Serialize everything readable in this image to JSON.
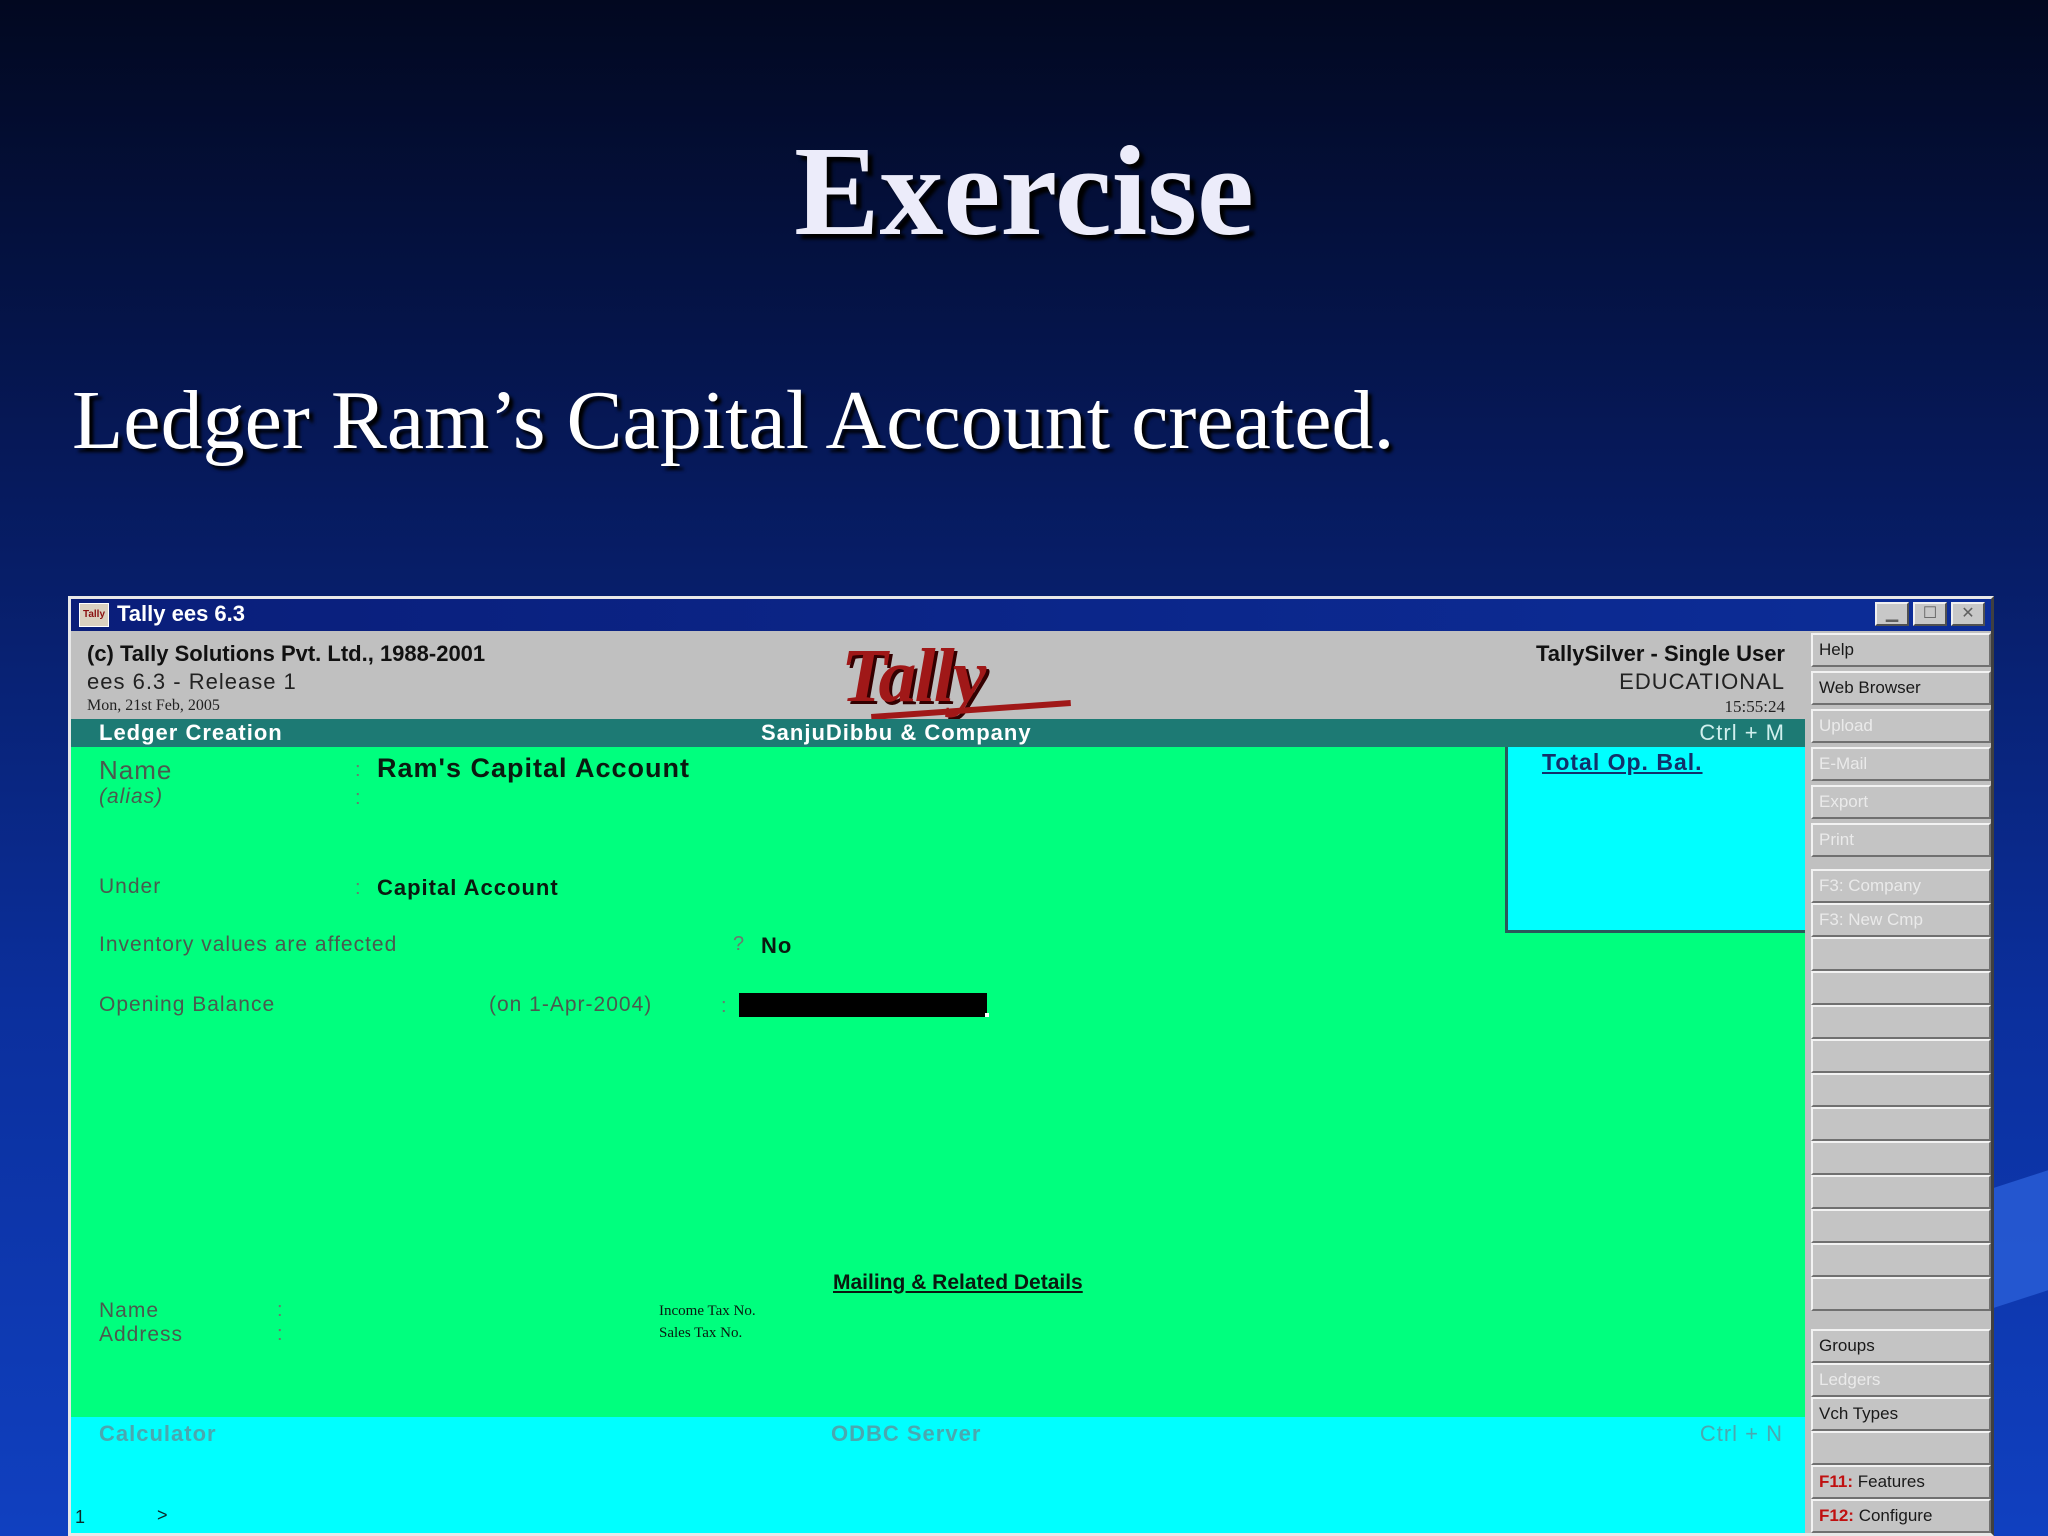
{
  "slide": {
    "title": "Exercise",
    "subtitle": "Ledger Ram’s Capital Account created."
  },
  "window": {
    "title": "Tally ees 6.3",
    "icon_text": "Tally",
    "controls": [
      "minimize-icon",
      "maximize-icon",
      "close-icon"
    ]
  },
  "header": {
    "copyright": "(c) Tally Solutions Pvt. Ltd., 1988-2001",
    "release": "ees 6.3 - Release 1",
    "date": "Mon, 21st Feb, 2005",
    "logo": "Tally",
    "product": "TallySilver - Single User",
    "edition": "EDUCATIONAL",
    "time": "15:55:24"
  },
  "strip": {
    "screen": "Ledger Creation",
    "company": "SanjuDibbu & Company",
    "shortcut": "Ctrl + M"
  },
  "form": {
    "name_label": "Name",
    "name_value": "Ram's Capital Account",
    "alias_label": "(alias)",
    "under_label": "Under",
    "under_value": "Capital Account",
    "inventory_label": "Inventory values are affected",
    "inventory_q": "?",
    "inventory_value": "No",
    "opening_label": "Opening Balance",
    "opening_date": "(on 1-Apr-2004)",
    "colon": ":"
  },
  "opbal_panel": {
    "title": "Total Op. Bal."
  },
  "mailing": {
    "title": "Mailing & Related Details",
    "name_label": "Name",
    "address_label": "Address",
    "income_tax_label": "Income Tax No.",
    "sales_tax_label": "Sales Tax No."
  },
  "bottom": {
    "calculator": "Calculator",
    "odbc": "ODBC Server",
    "shortcut": "Ctrl + N",
    "prompt_num": "1",
    "prompt": ">"
  },
  "sidebar": {
    "help": "Help",
    "web_browser": "Web Browser",
    "upload": "Upload",
    "email": "E-Mail",
    "export": "Export",
    "print": "Print",
    "f3_company": "F3: Company",
    "f3_new_cmp": "F3: New Cmp",
    "groups": "Groups",
    "ledgers": "Ledgers",
    "vch_types": "Vch Types",
    "f11_key": "F11:",
    "f11_label": "Features",
    "f12_key": "F12:",
    "f12_label": "Configure"
  }
}
